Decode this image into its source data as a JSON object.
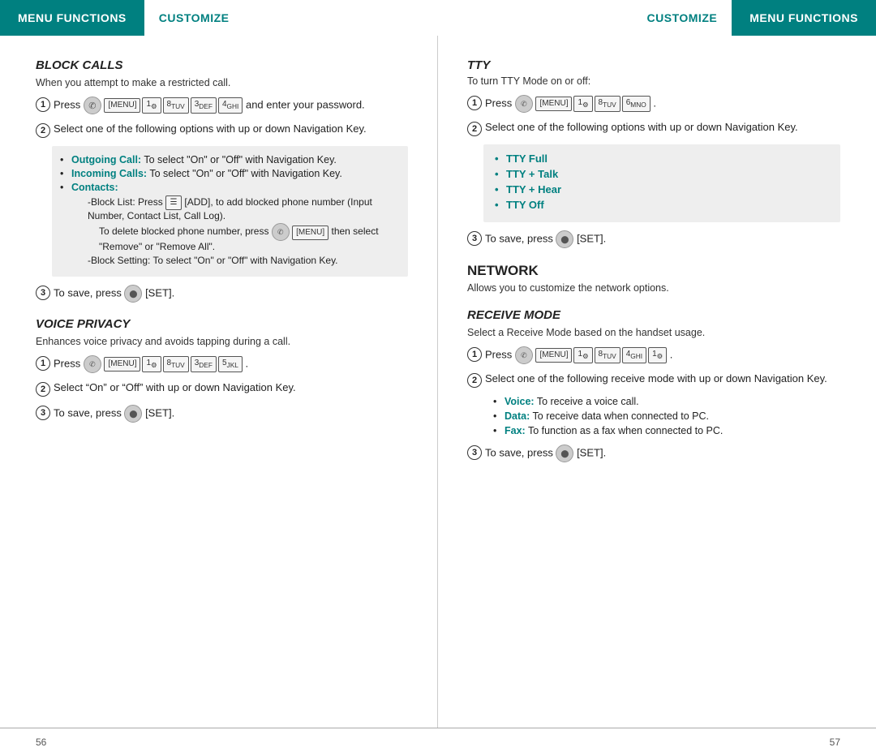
{
  "left_header": {
    "menu_functions": "MENU FUNCTIONS",
    "customize": "CUSTOMIZE"
  },
  "right_header": {
    "customize": "CUSTOMIZE",
    "menu_functions": "MENU FUNCTIONS"
  },
  "left_col": {
    "block_calls": {
      "title": "BLOCK CALLS",
      "subtitle": "When you attempt to make a restricted call.",
      "step1_text": "Press",
      "step1_keys": [
        "[MENU]",
        "1",
        "8",
        "3",
        "4"
      ],
      "step1_after": "and enter your password.",
      "step2_text": "Select one of the following options with up or down Navigation Key.",
      "bullets": [
        {
          "label": "Outgoing Call:",
          "text": "To select “On” or “Off” with Navigation Key."
        },
        {
          "label": "Incoming Calls:",
          "text": "To select “On” or “Off” with Navigation Key."
        },
        {
          "label": "Contacts:",
          "text": ""
        }
      ],
      "contacts_sub1": "-Block List: Press",
      "contacts_sub1_key": "[ADD]",
      "contacts_sub1_text": ", to add blocked phone number (Input Number, Contact List, Call Log). To delete blocked phone number, press",
      "contacts_sub1_menu": "[MENU]",
      "contacts_sub1_after": "then select “Remove” or “Remove All”.",
      "contacts_sub2": "-Block Setting: To select “On” or “Off” with Navigation Key.",
      "step3_text": "To save, press",
      "step3_key": "[SET]."
    },
    "voice_privacy": {
      "title": "VOICE PRIVACY",
      "subtitle": "Enhances voice privacy and avoids tapping during a call.",
      "step1_text": "Press",
      "step1_keys": [
        "[MENU]",
        "1",
        "8",
        "3",
        "5"
      ],
      "step1_after": ".",
      "step2_text": "Select “On” or “Off” with up or down Navigation Key.",
      "step3_text": "To save, press",
      "step3_key": "[SET]."
    }
  },
  "right_col": {
    "tty": {
      "title": "TTY",
      "subtitle": "To turn TTY Mode on or off:",
      "step1_text": "Press",
      "step1_keys": [
        "[MENU]",
        "1",
        "8",
        "6"
      ],
      "step1_after": ".",
      "step2_text": "Select one of the following options with up or down Navigation Key.",
      "tty_options": [
        "TTY Full",
        "TTY + Talk",
        "TTY + Hear",
        "TTY Off"
      ],
      "step3_text": "To save, press",
      "step3_key": "[SET]."
    },
    "network": {
      "title": "NETWORK",
      "subtitle": "Allows you to customize the network options."
    },
    "receive_mode": {
      "title": "RECEIVE MODE",
      "subtitle": "Select a Receive Mode based on the handset usage.",
      "step1_text": "Press",
      "step1_keys": [
        "[MENU]",
        "1",
        "8",
        "4",
        "1"
      ],
      "step1_after": ".",
      "step2_text": "Select one of the following receive mode with up or down Navigation Key.",
      "bullets": [
        {
          "label": "Voice:",
          "text": "To receive a voice call."
        },
        {
          "label": "Data:",
          "text": "To receive data when connected to PC."
        },
        {
          "label": "Fax:",
          "text": "To function as a fax when connected to PC."
        }
      ],
      "step3_text": "To save, press",
      "step3_key": "[SET]."
    }
  },
  "footer": {
    "left_page": "56",
    "right_page": "57"
  }
}
